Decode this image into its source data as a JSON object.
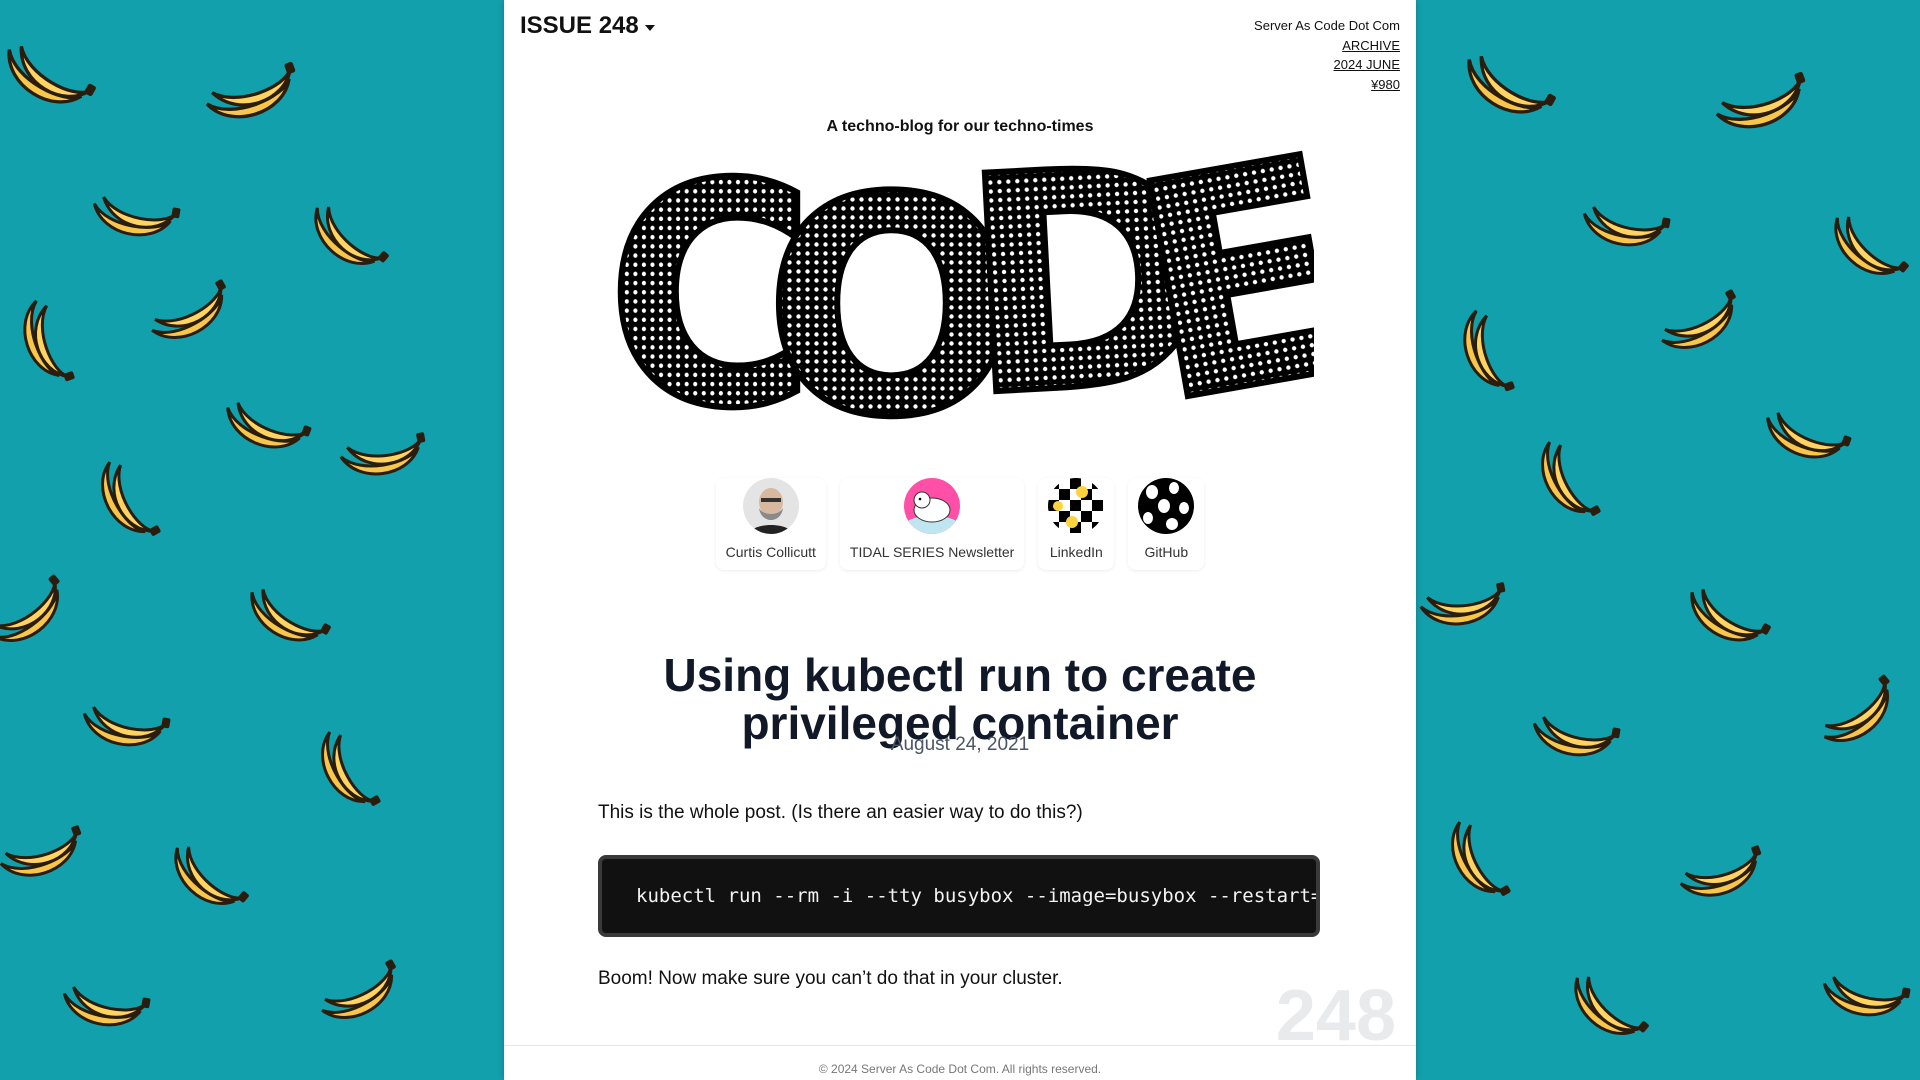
{
  "header": {
    "issue_label": "ISSUE 248",
    "site_name": "Server As Code Dot Com",
    "links": [
      "ARCHIVE",
      "2024 JUNE",
      "¥980"
    ]
  },
  "tagline": "A techno-blog for our techno-times",
  "logo_text": "CODE",
  "profiles": [
    {
      "label": "Curtis Collicutt"
    },
    {
      "label": "TIDAL SERIES Newsletter"
    },
    {
      "label": "LinkedIn"
    },
    {
      "label": "GitHub"
    }
  ],
  "post": {
    "title": "Using kubectl run to create privileged container",
    "date": "August 24, 2021",
    "intro": "This is the whole post. (Is there an easier way to do this?)",
    "code": "kubectl run --rm -i --tty busybox --image=busybox --restart=Never",
    "outro": "Boom! Now make sure you can’t do that in your cluster."
  },
  "issue_number_watermark": "248",
  "footer": "© 2024 Server As Code Dot Com. All rights reserved.",
  "colors": {
    "background": "#13a0ad",
    "banana": "#f7c64a",
    "page": "#ffffff",
    "code_bg": "#111111"
  }
}
